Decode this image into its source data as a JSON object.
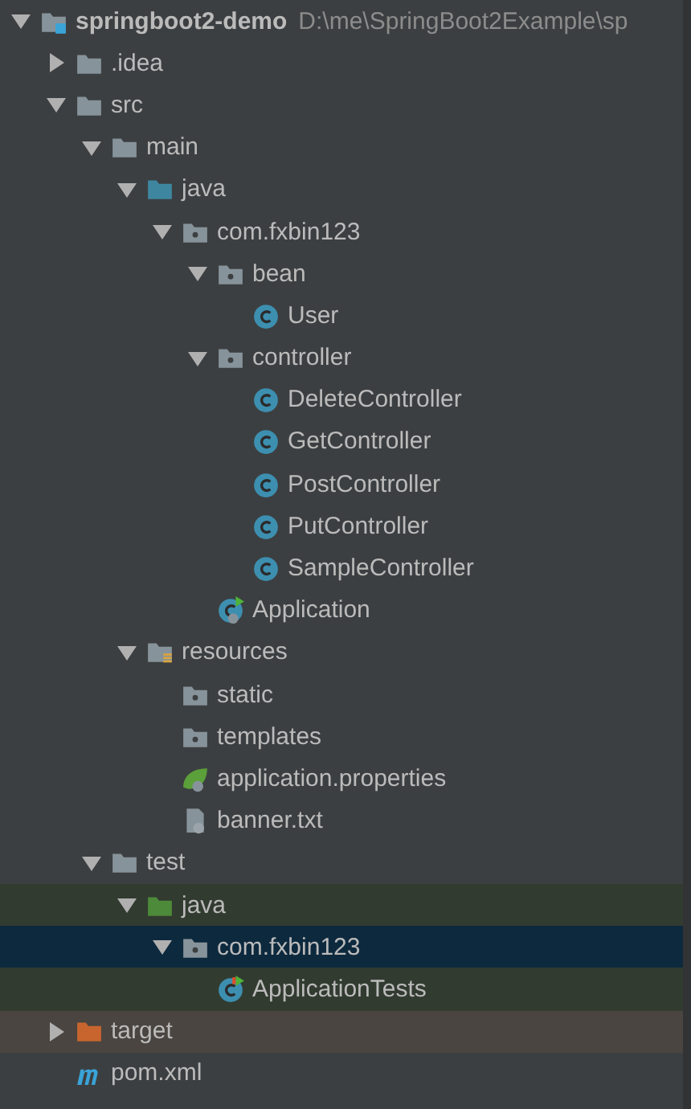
{
  "project_tree": [
    {
      "label": "springboot2-demo",
      "path": "D:\\me\\SpringBoot2Example\\sp",
      "kind": "module",
      "expanded": true,
      "selected": false,
      "children": [
        {
          "label": ".idea",
          "kind": "folder",
          "expanded": false,
          "selected": false
        },
        {
          "label": "src",
          "kind": "folder",
          "expanded": true,
          "selected": false,
          "children": [
            {
              "label": "main",
              "kind": "folder",
              "expanded": true,
              "selected": false,
              "children": [
                {
                  "label": "java",
                  "kind": "source-folder",
                  "expanded": true,
                  "selected": false,
                  "children": [
                    {
                      "label": "com.fxbin123",
                      "kind": "package",
                      "expanded": true,
                      "selected": false,
                      "children": [
                        {
                          "label": "bean",
                          "kind": "package",
                          "expanded": true,
                          "selected": false,
                          "children": [
                            {
                              "label": "User",
                              "kind": "class",
                              "selected": false
                            }
                          ]
                        },
                        {
                          "label": "controller",
                          "kind": "package",
                          "expanded": true,
                          "selected": false,
                          "children": [
                            {
                              "label": "DeleteController",
                              "kind": "class",
                              "selected": false
                            },
                            {
                              "label": "GetController",
                              "kind": "class",
                              "selected": false
                            },
                            {
                              "label": "PostController",
                              "kind": "class",
                              "selected": false
                            },
                            {
                              "label": "PutController",
                              "kind": "class",
                              "selected": false
                            },
                            {
                              "label": "SampleController",
                              "kind": "class",
                              "selected": false
                            }
                          ]
                        },
                        {
                          "label": "Application",
                          "kind": "app-class",
                          "selected": false
                        }
                      ]
                    }
                  ]
                },
                {
                  "label": "resources",
                  "kind": "resources-folder",
                  "expanded": true,
                  "selected": false,
                  "children": [
                    {
                      "label": "static",
                      "kind": "package",
                      "selected": false
                    },
                    {
                      "label": "templates",
                      "kind": "package",
                      "selected": false
                    },
                    {
                      "label": "application.properties",
                      "kind": "spring-config",
                      "selected": false
                    },
                    {
                      "label": "banner.txt",
                      "kind": "text-file",
                      "selected": false
                    }
                  ]
                }
              ]
            },
            {
              "label": "test",
              "kind": "folder",
              "expanded": true,
              "selected": false,
              "children": [
                {
                  "label": "java",
                  "kind": "test-folder",
                  "expanded": true,
                  "selected": false,
                  "children": [
                    {
                      "label": "com.fxbin123",
                      "kind": "package",
                      "expanded": true,
                      "selected": true,
                      "children": [
                        {
                          "label": "ApplicationTests",
                          "kind": "test-class",
                          "selected": false
                        }
                      ]
                    }
                  ]
                }
              ]
            }
          ]
        },
        {
          "label": "target",
          "kind": "excluded-folder",
          "expanded": false,
          "selected": false
        },
        {
          "label": "pom.xml",
          "kind": "maven",
          "selected": false
        }
      ]
    }
  ]
}
